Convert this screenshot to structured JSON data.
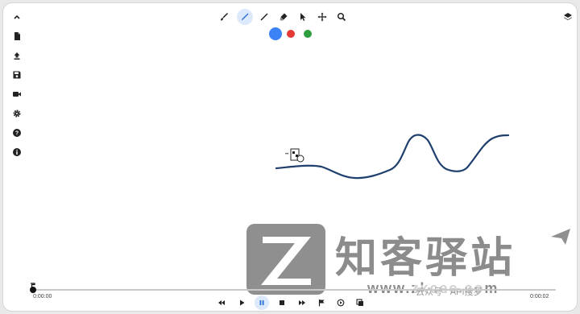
{
  "sidebar": {
    "items": [
      {
        "icon": "chevron-up-icon"
      },
      {
        "icon": "file-icon"
      },
      {
        "icon": "upload-icon"
      },
      {
        "icon": "save-icon"
      },
      {
        "icon": "video-camera-icon"
      },
      {
        "icon": "settings-icon"
      },
      {
        "icon": "help-icon"
      },
      {
        "icon": "info-icon"
      }
    ]
  },
  "toolbar": {
    "tools": [
      {
        "icon": "brush-icon"
      },
      {
        "icon": "pen-icon",
        "active": true
      },
      {
        "icon": "line-icon"
      },
      {
        "icon": "eraser-icon"
      },
      {
        "icon": "pointer-icon"
      },
      {
        "icon": "move-icon"
      },
      {
        "icon": "zoom-icon"
      }
    ],
    "layers_icon": "layers-icon"
  },
  "colors": {
    "swatches": [
      "#3b82f6",
      "#e53935",
      "#2e9e3e"
    ],
    "selected": "#3b82f6"
  },
  "canvas": {
    "stroke_color": "#1f3f6e"
  },
  "timeline": {
    "current_time": "0:00:00",
    "total_time": "0:00:02",
    "progress": 0
  },
  "playback": {
    "controls": [
      {
        "icon": "rewind-icon"
      },
      {
        "icon": "play-icon"
      },
      {
        "icon": "pause-icon",
        "active": true
      },
      {
        "icon": "stop-icon"
      },
      {
        "icon": "fast-forward-icon"
      },
      {
        "icon": "flag-icon"
      },
      {
        "icon": "replay-icon"
      },
      {
        "icon": "copy-frames-icon"
      }
    ]
  },
  "watermark": {
    "title": "知客驿站",
    "url": "www.zkcee.com",
    "sub": "云众号 · API搜罗"
  }
}
